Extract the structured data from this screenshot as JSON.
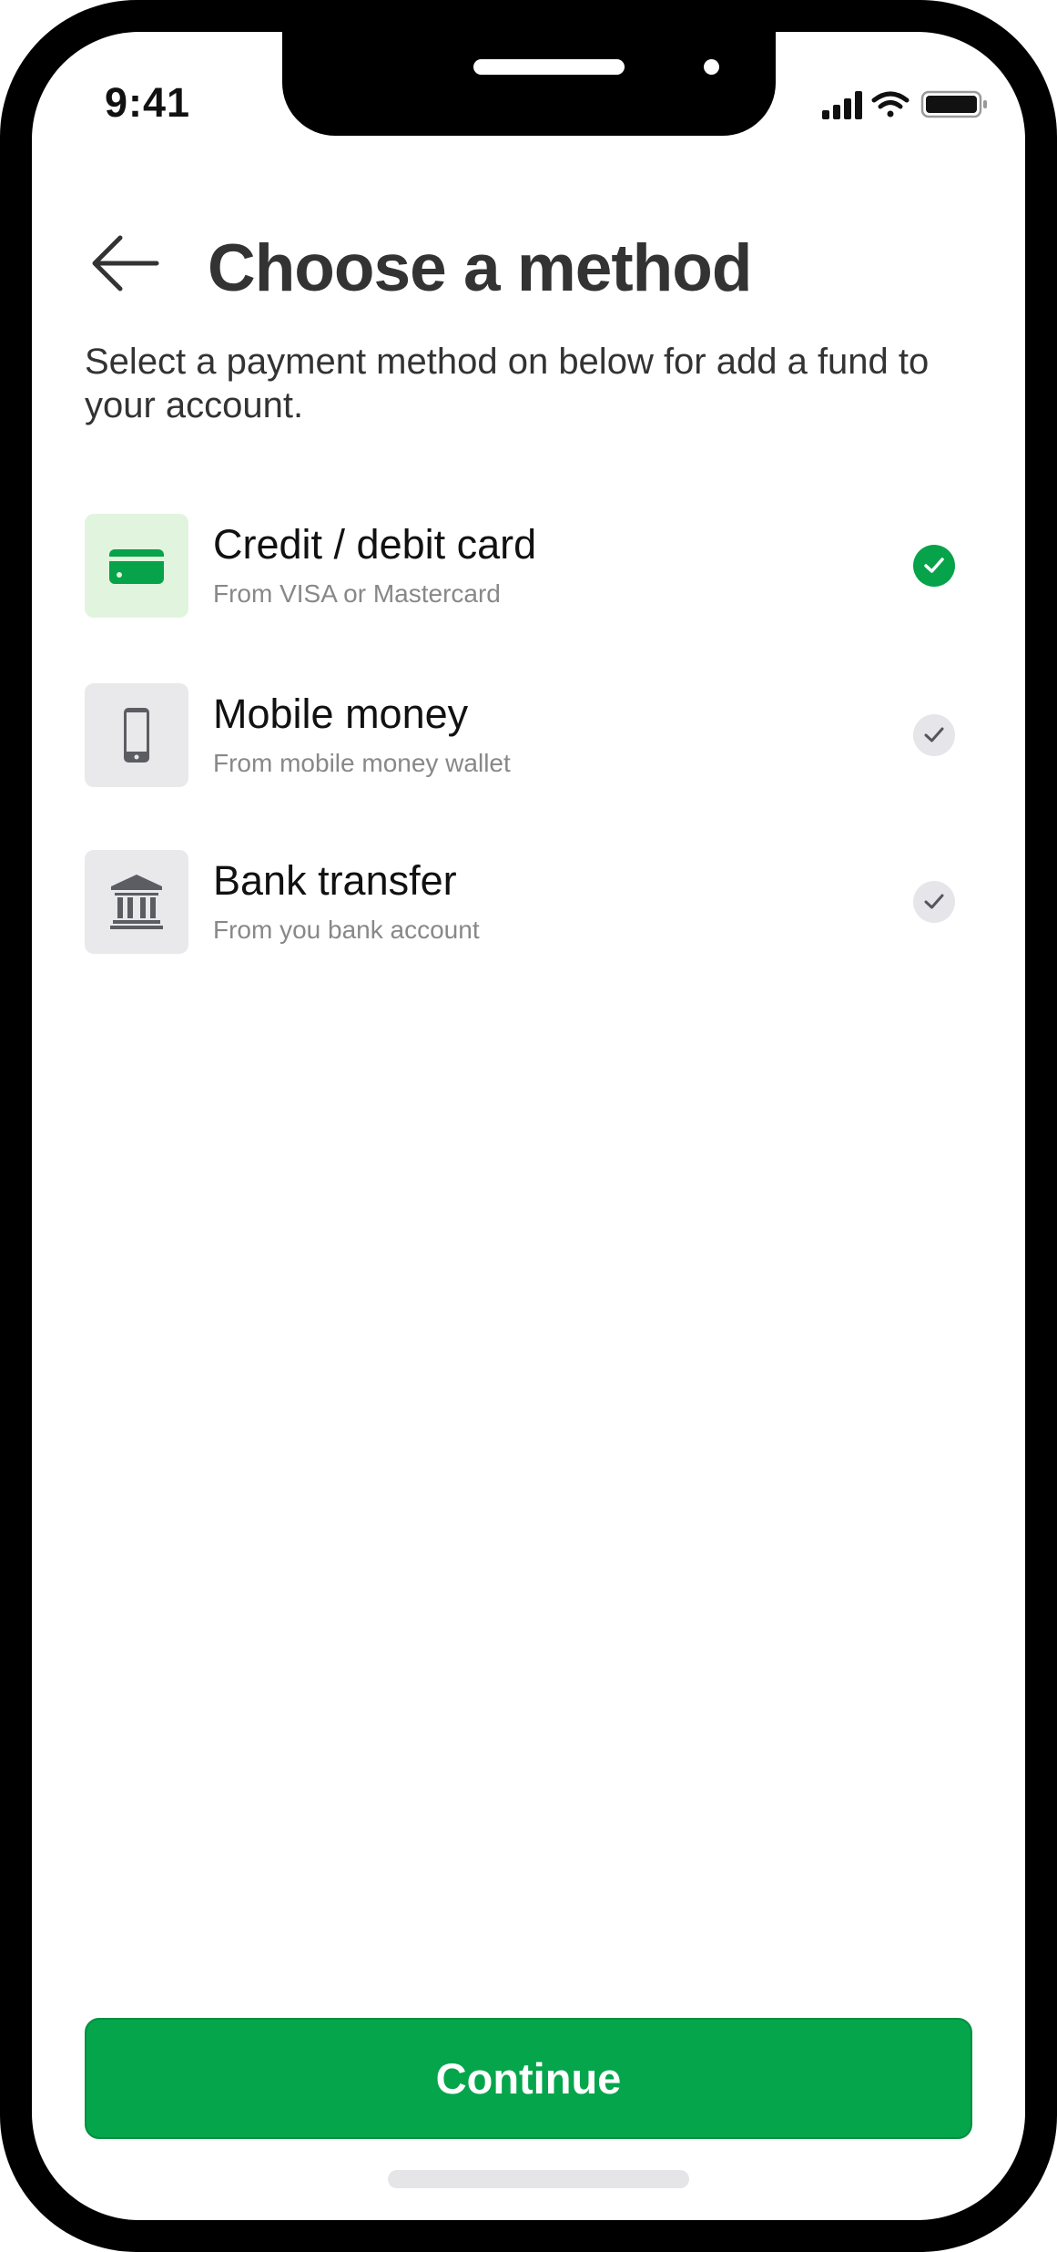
{
  "status_bar": {
    "time": "9:41"
  },
  "header": {
    "title": "Choose a method"
  },
  "subtitle": "Select a payment method on below for add a fund to your account.",
  "methods": [
    {
      "title": "Credit / debit card",
      "subtitle": "From VISA or Mastercard",
      "icon": "credit-card-icon",
      "selected": true
    },
    {
      "title": "Mobile money",
      "subtitle": "From mobile money wallet",
      "icon": "mobile-phone-icon",
      "selected": false
    },
    {
      "title": "Bank transfer",
      "subtitle": "From you bank account",
      "icon": "bank-icon",
      "selected": false
    }
  ],
  "continue_label": "Continue",
  "colors": {
    "accent": "#05a54b",
    "selected_icon_bg": "#e1f5de",
    "neutral_icon_bg": "#e9e9ec",
    "text": "#333333",
    "muted": "#888888"
  }
}
